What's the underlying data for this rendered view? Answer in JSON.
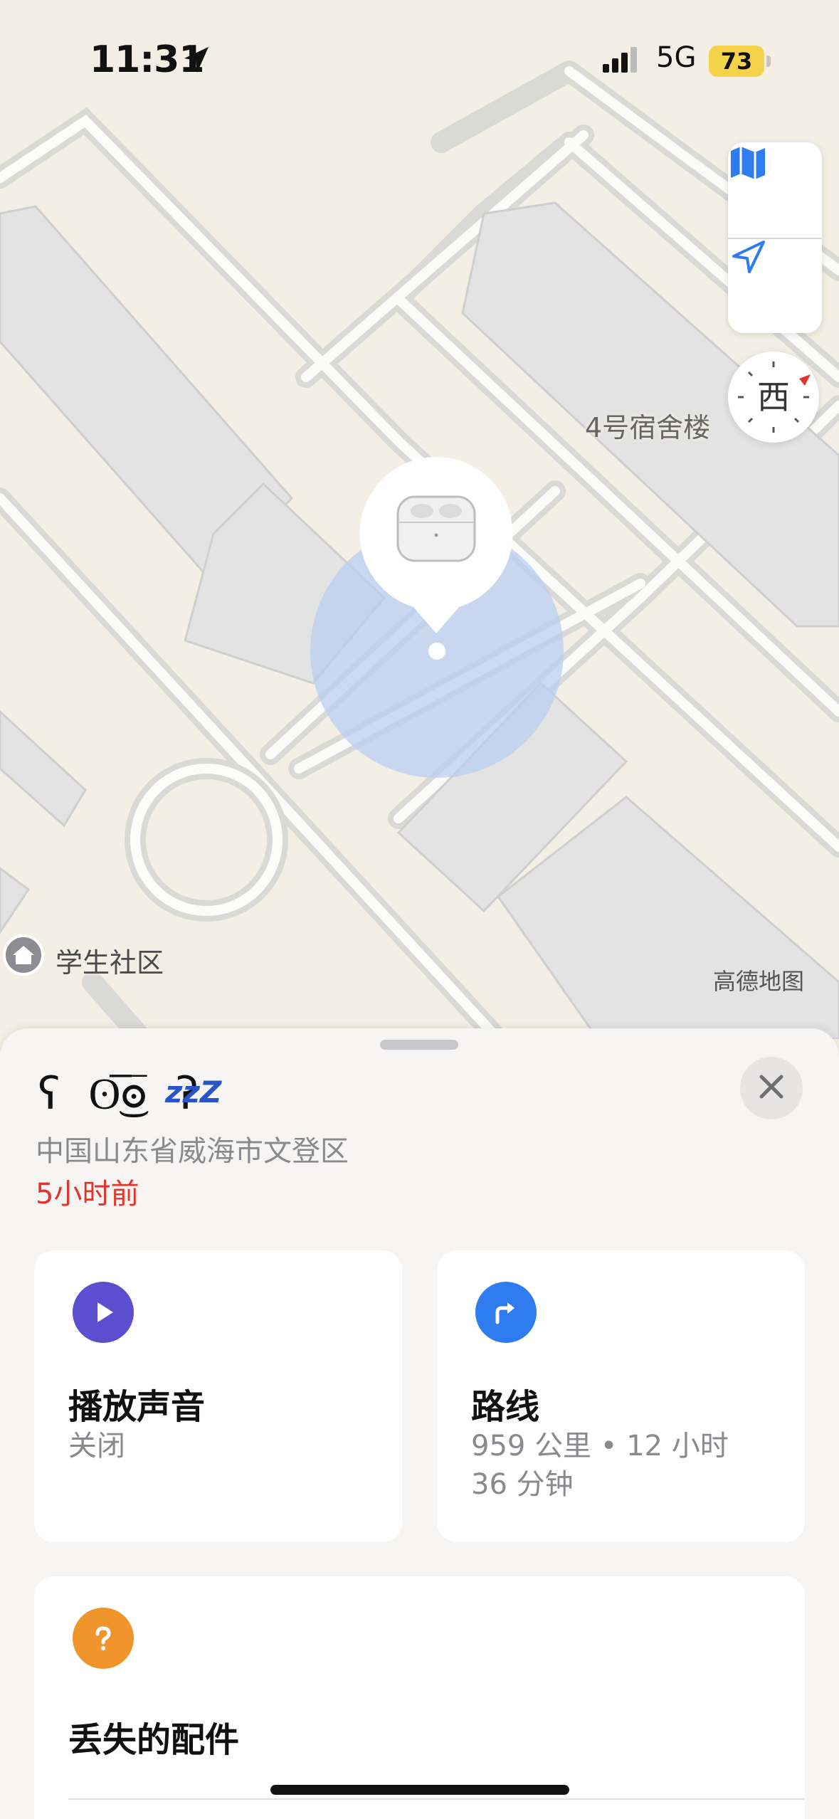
{
  "status_bar": {
    "time": "11:31",
    "network": "5G",
    "battery": "73",
    "battery_color": "#f4d24a"
  },
  "map": {
    "building_label": "4号宿舍楼",
    "poi_label": "学生社区",
    "provider": "高德地图",
    "compass_heading": "西",
    "accuracy_circle_color": "#b9cff0",
    "device_icon": "airpods-case-icon"
  },
  "sheet": {
    "device_name": "ʕ ʘ̅͜ʘ̅ ʔ",
    "sleep_indicator": "zzZ",
    "address": "中国山东省威海市文登区",
    "time_ago": "5小时前",
    "time_ago_color": "#e0352b",
    "cards": {
      "sound": {
        "title": "播放声音",
        "subtitle": "关闭",
        "icon": "play-icon",
        "icon_color": "#5b4fcf"
      },
      "directions": {
        "title": "路线",
        "subtitle_line1": "959 公里 • 12 小时",
        "subtitle_line2": "36 分钟",
        "icon": "turn-right-arrow-icon",
        "icon_color": "#2f7bf0"
      },
      "lost": {
        "title": "丢失的配件",
        "icon": "question-icon",
        "icon_color": "#f0952c"
      }
    }
  }
}
